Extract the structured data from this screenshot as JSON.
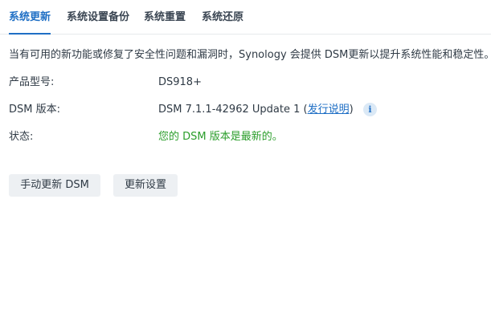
{
  "tabs": [
    {
      "label": "系统更新",
      "active": true
    },
    {
      "label": "系统设置备份",
      "active": false
    },
    {
      "label": "系统重置",
      "active": false
    },
    {
      "label": "系统还原",
      "active": false
    }
  ],
  "description": "当有可用的新功能或修复了安全性问题和漏洞时，Synology 会提供 DSM更新以提升系统性能和稳定性。",
  "info": {
    "model_label": "产品型号:",
    "model_value": "DS918+",
    "dsm_label": "DSM 版本:",
    "dsm_value": "DSM 7.1.1-42962 Update 1 (",
    "release_notes_link": "发行说明",
    "dsm_value_close": ")",
    "info_icon": "i",
    "status_label": "状态:",
    "status_value": "您的 DSM 版本是最新的。"
  },
  "buttons": {
    "manual_update": "手动更新 DSM",
    "update_settings": "更新设置"
  },
  "colors": {
    "accent": "#1f6fc5",
    "status_ok": "#2a9d2a",
    "button_bg": "#edf0f3"
  },
  "icons": {
    "info": "info-icon"
  }
}
